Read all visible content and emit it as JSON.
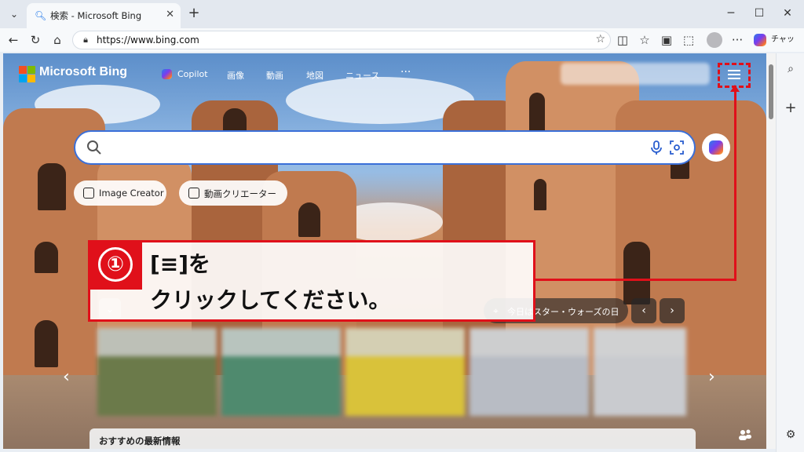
{
  "tab": {
    "title": "検索 - Microsoft Bing",
    "close": "✕"
  },
  "address": {
    "url": "https://www.bing.com"
  },
  "chat_button": {
    "label": "チャット"
  },
  "bing": {
    "brand": "Microsoft Bing",
    "nav": {
      "copilot": "Copilot",
      "images": "画像",
      "videos": "動画",
      "maps": "地図",
      "news": "ニュース",
      "more": "···"
    }
  },
  "search": {
    "value": "",
    "placeholder": ""
  },
  "pills": {
    "image_creator": "Image Creator",
    "video_creator": "動画クリエーター"
  },
  "annotation": {
    "step": "①",
    "line1": "[≡]を",
    "line2": "クリックしてください。"
  },
  "today": {
    "label": "今日はスター・ウォーズの日"
  },
  "news": {
    "label": "おすすめの最新情報"
  },
  "colors": {
    "accent_red": "#e0101a",
    "search_border": "#3a6fd8"
  },
  "icons": {
    "menu": "hamburger-icon",
    "search": "search-icon",
    "mic": "microphone-icon",
    "visual": "visual-search-icon"
  }
}
